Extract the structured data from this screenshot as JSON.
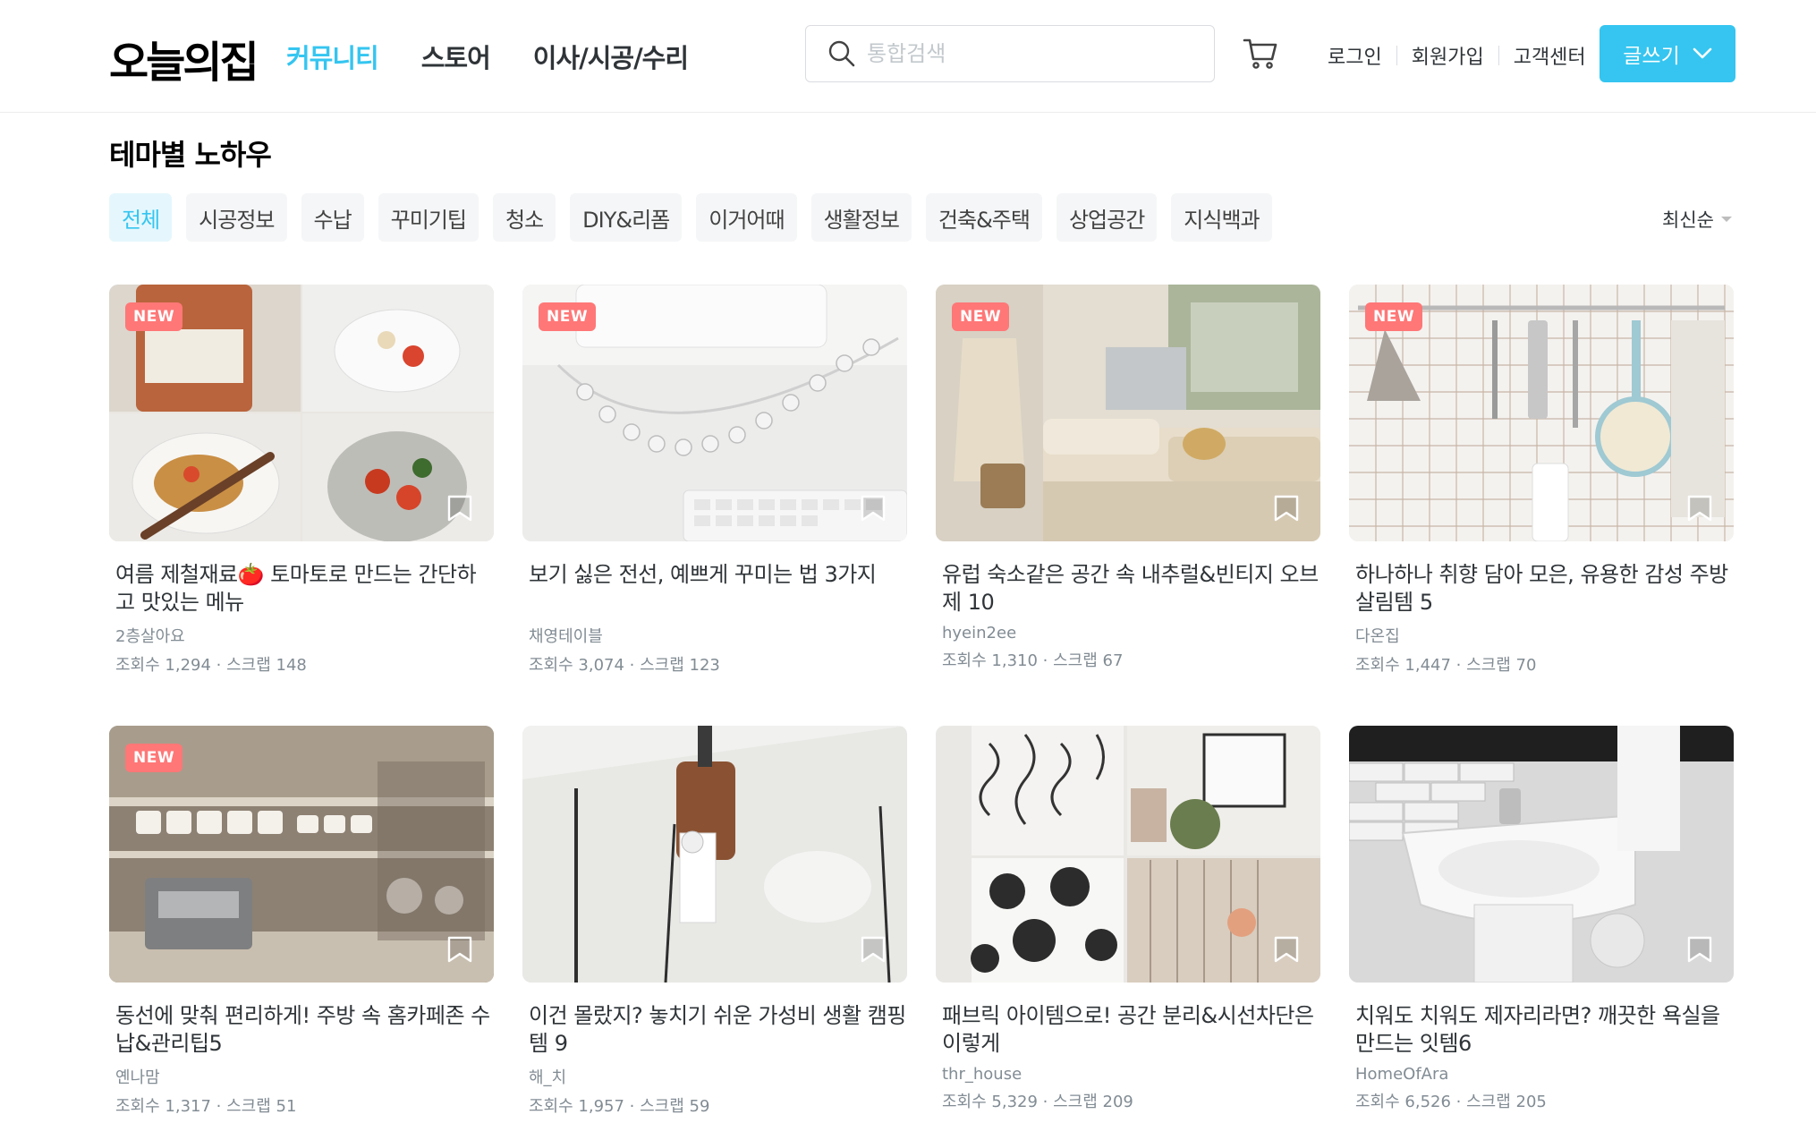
{
  "header": {
    "logo": "오늘의집",
    "nav": [
      {
        "label": "커뮤니티",
        "active": true
      },
      {
        "label": "스토어",
        "active": false
      },
      {
        "label": "이사/시공/수리",
        "active": false
      }
    ],
    "search": {
      "placeholder": "통합검색",
      "value": ""
    },
    "util_links": [
      "로그인",
      "회원가입",
      "고객센터"
    ],
    "write_button": "글쓰기"
  },
  "section": {
    "title": "테마별 노하우"
  },
  "chips": [
    {
      "label": "전체",
      "active": true
    },
    {
      "label": "시공정보",
      "active": false
    },
    {
      "label": "수납",
      "active": false
    },
    {
      "label": "꾸미기팁",
      "active": false
    },
    {
      "label": "청소",
      "active": false
    },
    {
      "label": "DIY&리폼",
      "active": false
    },
    {
      "label": "이거어때",
      "active": false
    },
    {
      "label": "생활정보",
      "active": false
    },
    {
      "label": "건축&주택",
      "active": false
    },
    {
      "label": "상업공간",
      "active": false
    },
    {
      "label": "지식백과",
      "active": false
    }
  ],
  "sort": {
    "label": "최신순"
  },
  "cards": [
    {
      "title": "여름 제철재료🍅 토마토로 만드는 간단하고 맛있는 메뉴",
      "author": "2층살아요",
      "stats": "조회수 1,294 · 스크랩 148",
      "badge": "NEW"
    },
    {
      "title": "보기 싫은 전선, 예쁘게 꾸미는 법 3가지",
      "author": "채영테이블",
      "stats": "조회수 3,074 · 스크랩 123",
      "badge": "NEW"
    },
    {
      "title": "유럽 숙소같은 공간 속 내추럴&빈티지 오브제 10",
      "author": "hyein2ee",
      "stats": "조회수 1,310 · 스크랩 67",
      "badge": "NEW"
    },
    {
      "title": "하나하나 취향 담아 모은, 유용한 감성 주방 살림템 5",
      "author": "다온집",
      "stats": "조회수 1,447 · 스크랩 70",
      "badge": "NEW"
    },
    {
      "title": "동선에 맞춰 편리하게! 주방 속 홈카페존 수납&관리팁5",
      "author": "옌나맘",
      "stats": "조회수 1,317 · 스크랩 51",
      "badge": "NEW"
    },
    {
      "title": "이건 몰랐지? 놓치기 쉬운 가성비 생활 캠핑템 9",
      "author": "해_치",
      "stats": "조회수 1,957 · 스크랩 59",
      "badge": ""
    },
    {
      "title": "패브릭 아이템으로! 공간 분리&시선차단은 이렇게",
      "author": "thr_house",
      "stats": "조회수 5,329 · 스크랩 209",
      "badge": ""
    },
    {
      "title": "치워도 치워도 제자리라면? 깨끗한 욕실을 만드는 잇템6",
      "author": "HomeOfAra",
      "stats": "조회수 6,526 · 스크랩 205",
      "badge": ""
    }
  ]
}
